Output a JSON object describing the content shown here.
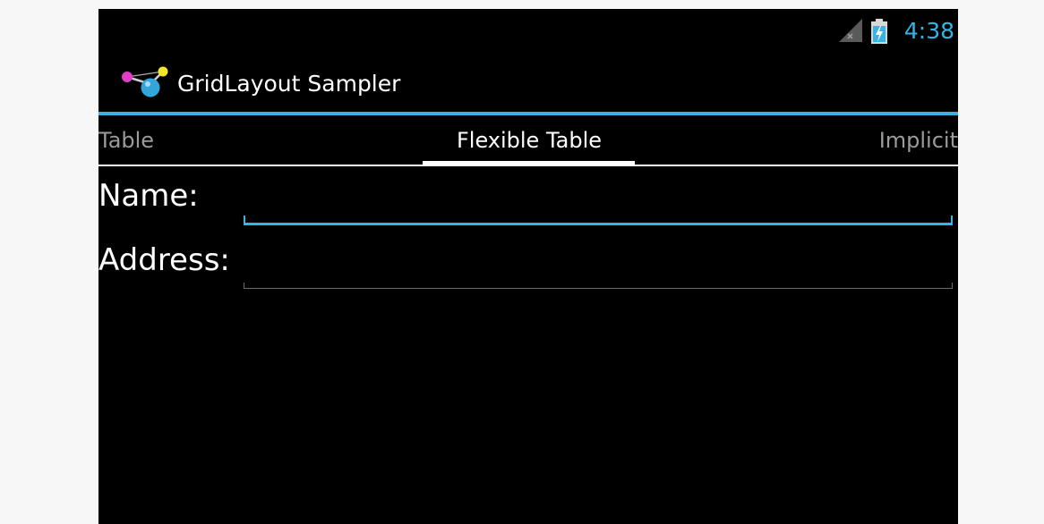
{
  "status_bar": {
    "time": "4:38",
    "signal_icon": "signal-no-service-icon",
    "battery_icon": "battery-charging-icon"
  },
  "action_bar": {
    "title": "GridLayout Sampler",
    "icon": "molecule-app-icon"
  },
  "tabs": {
    "previous": "Table",
    "current": "Flexible Table",
    "next": "Implicit"
  },
  "form": {
    "name_label": "Name:",
    "name_value": "",
    "address_label": "Address:",
    "address_value": ""
  },
  "colors": {
    "accent": "#33b5e5",
    "background": "#000000",
    "text": "#ffffff",
    "inactive_tab": "#9b9b9b"
  }
}
